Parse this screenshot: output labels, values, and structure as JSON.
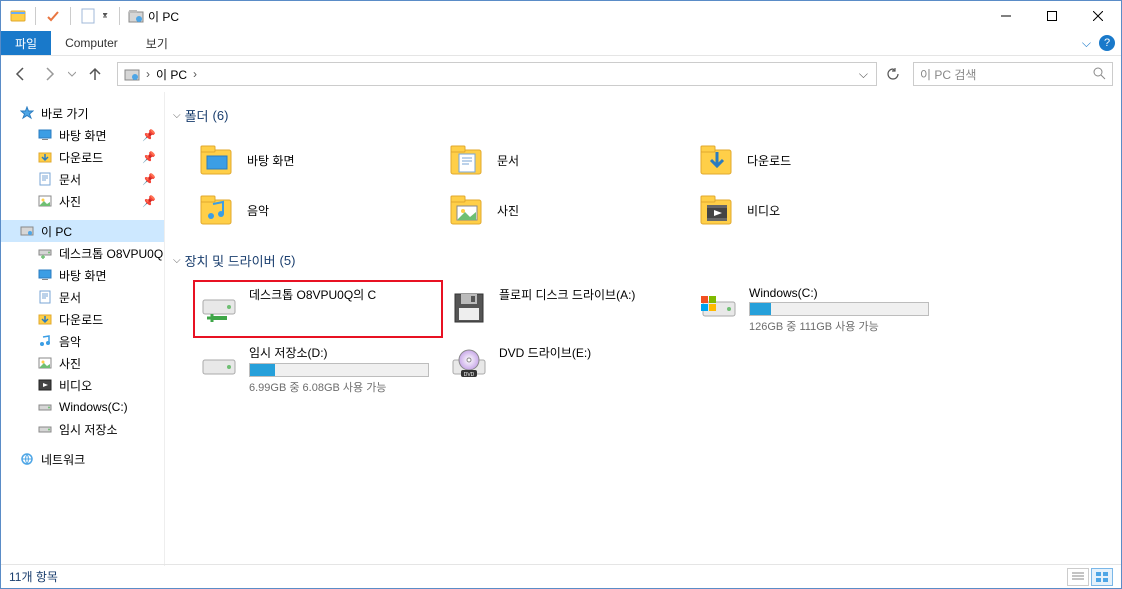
{
  "window": {
    "title": "이 PC"
  },
  "ribbon": {
    "file": "파일",
    "tabs": [
      "Computer",
      "보기"
    ]
  },
  "address": {
    "crumbs": [
      "이 PC"
    ],
    "search_placeholder": "이 PC 검색"
  },
  "sidebar": {
    "quick_access": "바로 가기",
    "quick_items": [
      {
        "label": "바탕 화면",
        "pin": true,
        "icon": "desktop"
      },
      {
        "label": "다운로드",
        "pin": true,
        "icon": "downloads"
      },
      {
        "label": "문서",
        "pin": true,
        "icon": "documents"
      },
      {
        "label": "사진",
        "pin": true,
        "icon": "pictures"
      }
    ],
    "this_pc": "이 PC",
    "pc_items": [
      {
        "label": "데스크톱 O8VPU0Q",
        "icon": "network-drive"
      },
      {
        "label": "바탕 화면",
        "icon": "desktop"
      },
      {
        "label": "문서",
        "icon": "documents"
      },
      {
        "label": "다운로드",
        "icon": "downloads"
      },
      {
        "label": "음악",
        "icon": "music"
      },
      {
        "label": "사진",
        "icon": "pictures"
      },
      {
        "label": "비디오",
        "icon": "videos"
      },
      {
        "label": "Windows(C:)",
        "icon": "drive"
      },
      {
        "label": "임시 저장소",
        "icon": "drive"
      }
    ],
    "network": "네트워크"
  },
  "main": {
    "folders_header_label": "폴더",
    "folders_header_count": "(6)",
    "folders": [
      {
        "label": "바탕 화면",
        "icon": "desktop-folder"
      },
      {
        "label": "문서",
        "icon": "documents-folder"
      },
      {
        "label": "다운로드",
        "icon": "downloads-folder"
      },
      {
        "label": "음악",
        "icon": "music-folder"
      },
      {
        "label": "사진",
        "icon": "pictures-folder"
      },
      {
        "label": "비디오",
        "icon": "videos-folder"
      }
    ],
    "drives_header_label": "장치 및 드라이버",
    "drives_header_count": "(5)",
    "drives": [
      {
        "label": "데스크톱 O8VPU0Q의 C",
        "icon": "network-drive",
        "highlighted": true,
        "show_bar": false
      },
      {
        "label": "플로피 디스크 드라이브(A:)",
        "icon": "floppy",
        "show_bar": false
      },
      {
        "label": "Windows(C:)",
        "icon": "windows-drive",
        "show_bar": true,
        "fill_pct": 12,
        "usage": "126GB 중 111GB 사용 가능"
      },
      {
        "label": "임시 저장소(D:)",
        "icon": "drive",
        "show_bar": true,
        "fill_pct": 14,
        "usage": "6.99GB 중 6.08GB 사용 가능"
      },
      {
        "label": "DVD 드라이브(E:)",
        "icon": "dvd",
        "show_bar": false
      }
    ]
  },
  "status": {
    "text": "11개 항목"
  }
}
